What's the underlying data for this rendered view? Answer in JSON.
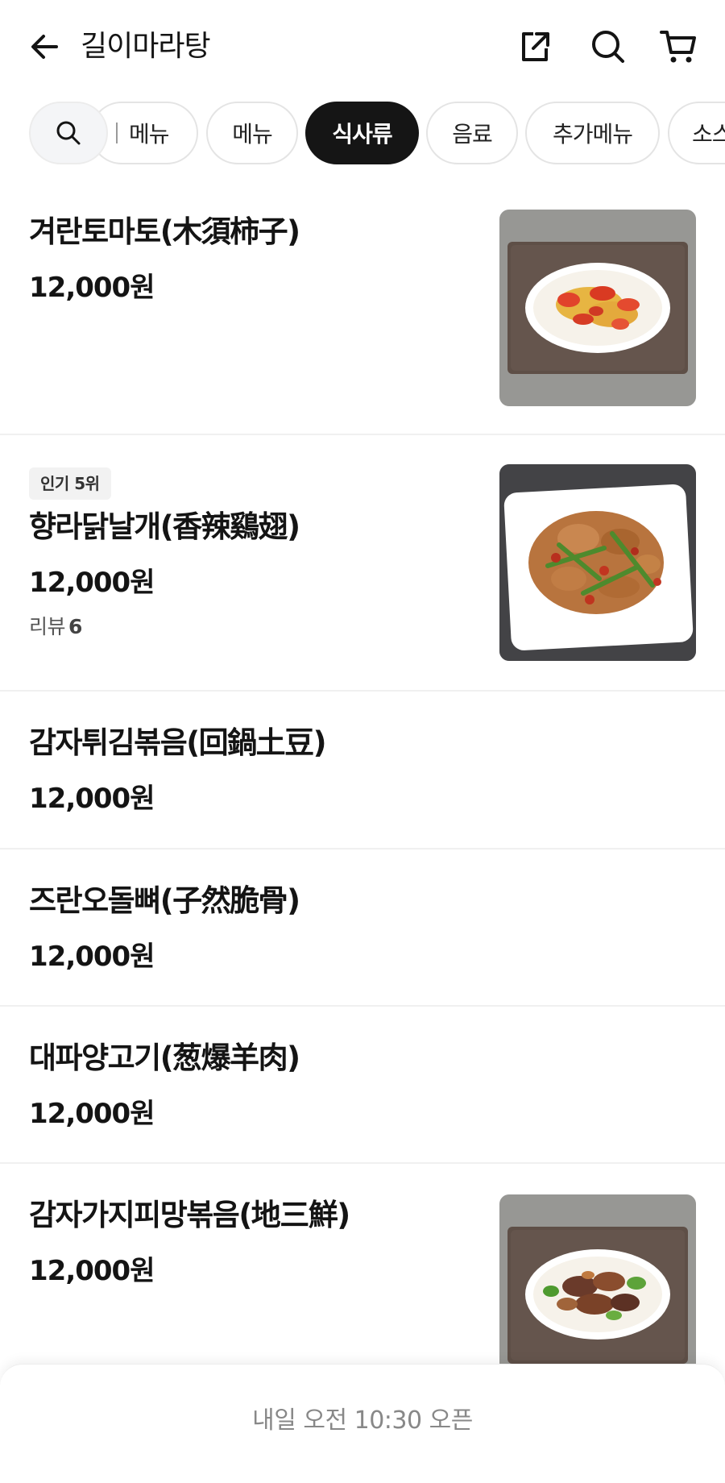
{
  "header": {
    "title": "길이마라탕",
    "icons": [
      "back-arrow-icon",
      "share-icon",
      "search-icon",
      "cart-icon"
    ]
  },
  "tabs": {
    "search_icon": "search-icon",
    "items": [
      {
        "label": "메뉴",
        "active": false
      },
      {
        "label": "메뉴",
        "active": false
      },
      {
        "label": "식사류",
        "active": true
      },
      {
        "label": "음료",
        "active": false
      },
      {
        "label": "추가메뉴",
        "active": false
      },
      {
        "label": "소스",
        "active": false
      }
    ]
  },
  "menu": [
    {
      "name": "겨란토마토(木須柿子)",
      "price": "12,000원",
      "image": "egg-tomato-photo"
    },
    {
      "name": "향라닭날개(香辣鷄翅)",
      "price": "12,000원",
      "badge": "인기 5위",
      "review_label": "리뷰",
      "review_count": "6",
      "image": "spicy-chicken-wings-photo"
    },
    {
      "name": "감자튀김볶음(回鍋土豆)",
      "price": "12,000원"
    },
    {
      "name": "즈란오돌뼈(子然脆骨)",
      "price": "12,000원"
    },
    {
      "name": "대파양고기(葱爆羊肉)",
      "price": "12,000원"
    },
    {
      "name": "감자가지피망볶음(地三鮮)",
      "price": "12,000원",
      "image": "eggplant-potato-pepper-photo"
    }
  ],
  "footer": {
    "open_text": "내일 오전 10:30 오픈"
  },
  "colors": {
    "accent": "#151515",
    "text": "#141414",
    "muted": "#888888",
    "divider": "#f0f0f0"
  }
}
